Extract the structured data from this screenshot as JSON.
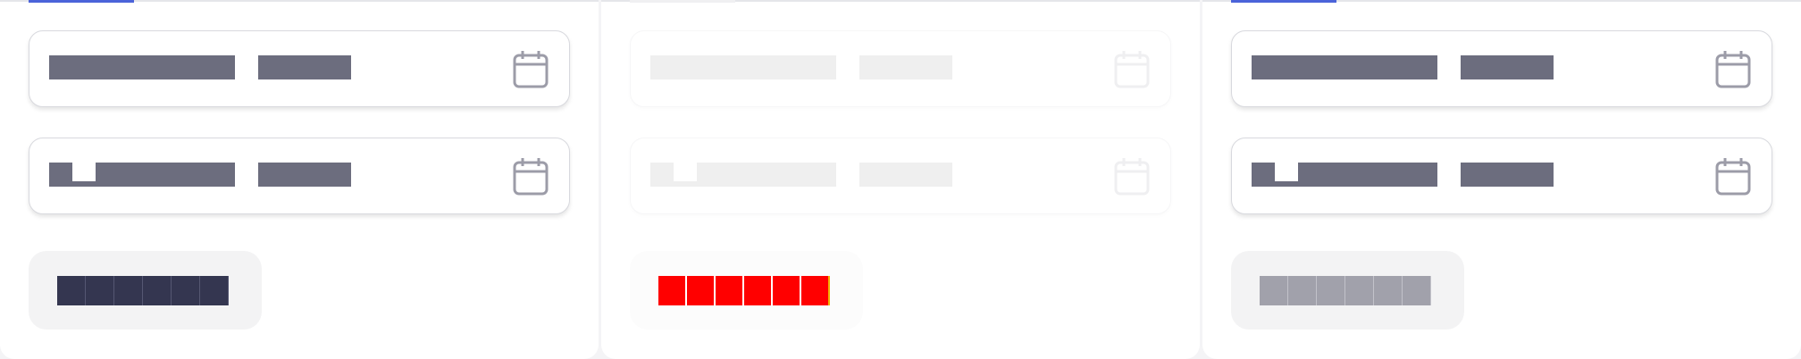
{
  "panels": [
    {
      "id": "default",
      "tab_color": "#4b63d9",
      "placeholder_color": "#6c6d7e",
      "otp_fill": "#343650",
      "otp_cells": 6
    },
    {
      "id": "disabled",
      "tab_color": "#f0f0f2",
      "placeholder_color": "#efefef",
      "otp_fill": "#ff0000",
      "otp_cells": 6
    },
    {
      "id": "light",
      "tab_color": "#4b63d9",
      "placeholder_color": "#6c6d7e",
      "otp_fill": "#a1a1ab",
      "otp_cells": 6
    }
  ],
  "icons": {
    "date_field": "calendar-icon"
  }
}
